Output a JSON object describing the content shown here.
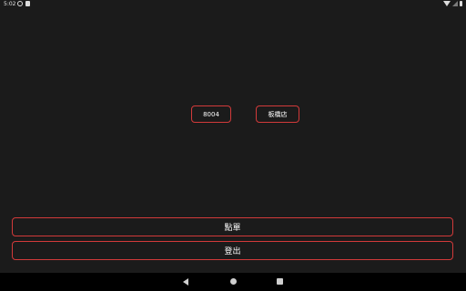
{
  "status_bar": {
    "time": "5:02",
    "icons": [
      "sync-icon",
      "sim-card-icon",
      "wifi-icon",
      "signal-icon",
      "battery-icon"
    ]
  },
  "info": {
    "code": "8004",
    "store": "板橋店"
  },
  "actions": {
    "order_label": "點單",
    "logout_label": "登出"
  },
  "nav": {
    "icons": [
      "back-icon",
      "home-icon",
      "recents-icon"
    ]
  },
  "colors": {
    "background": "#1b1b1b",
    "accent_border": "#d23a3a",
    "nav_bar": "#000000"
  }
}
